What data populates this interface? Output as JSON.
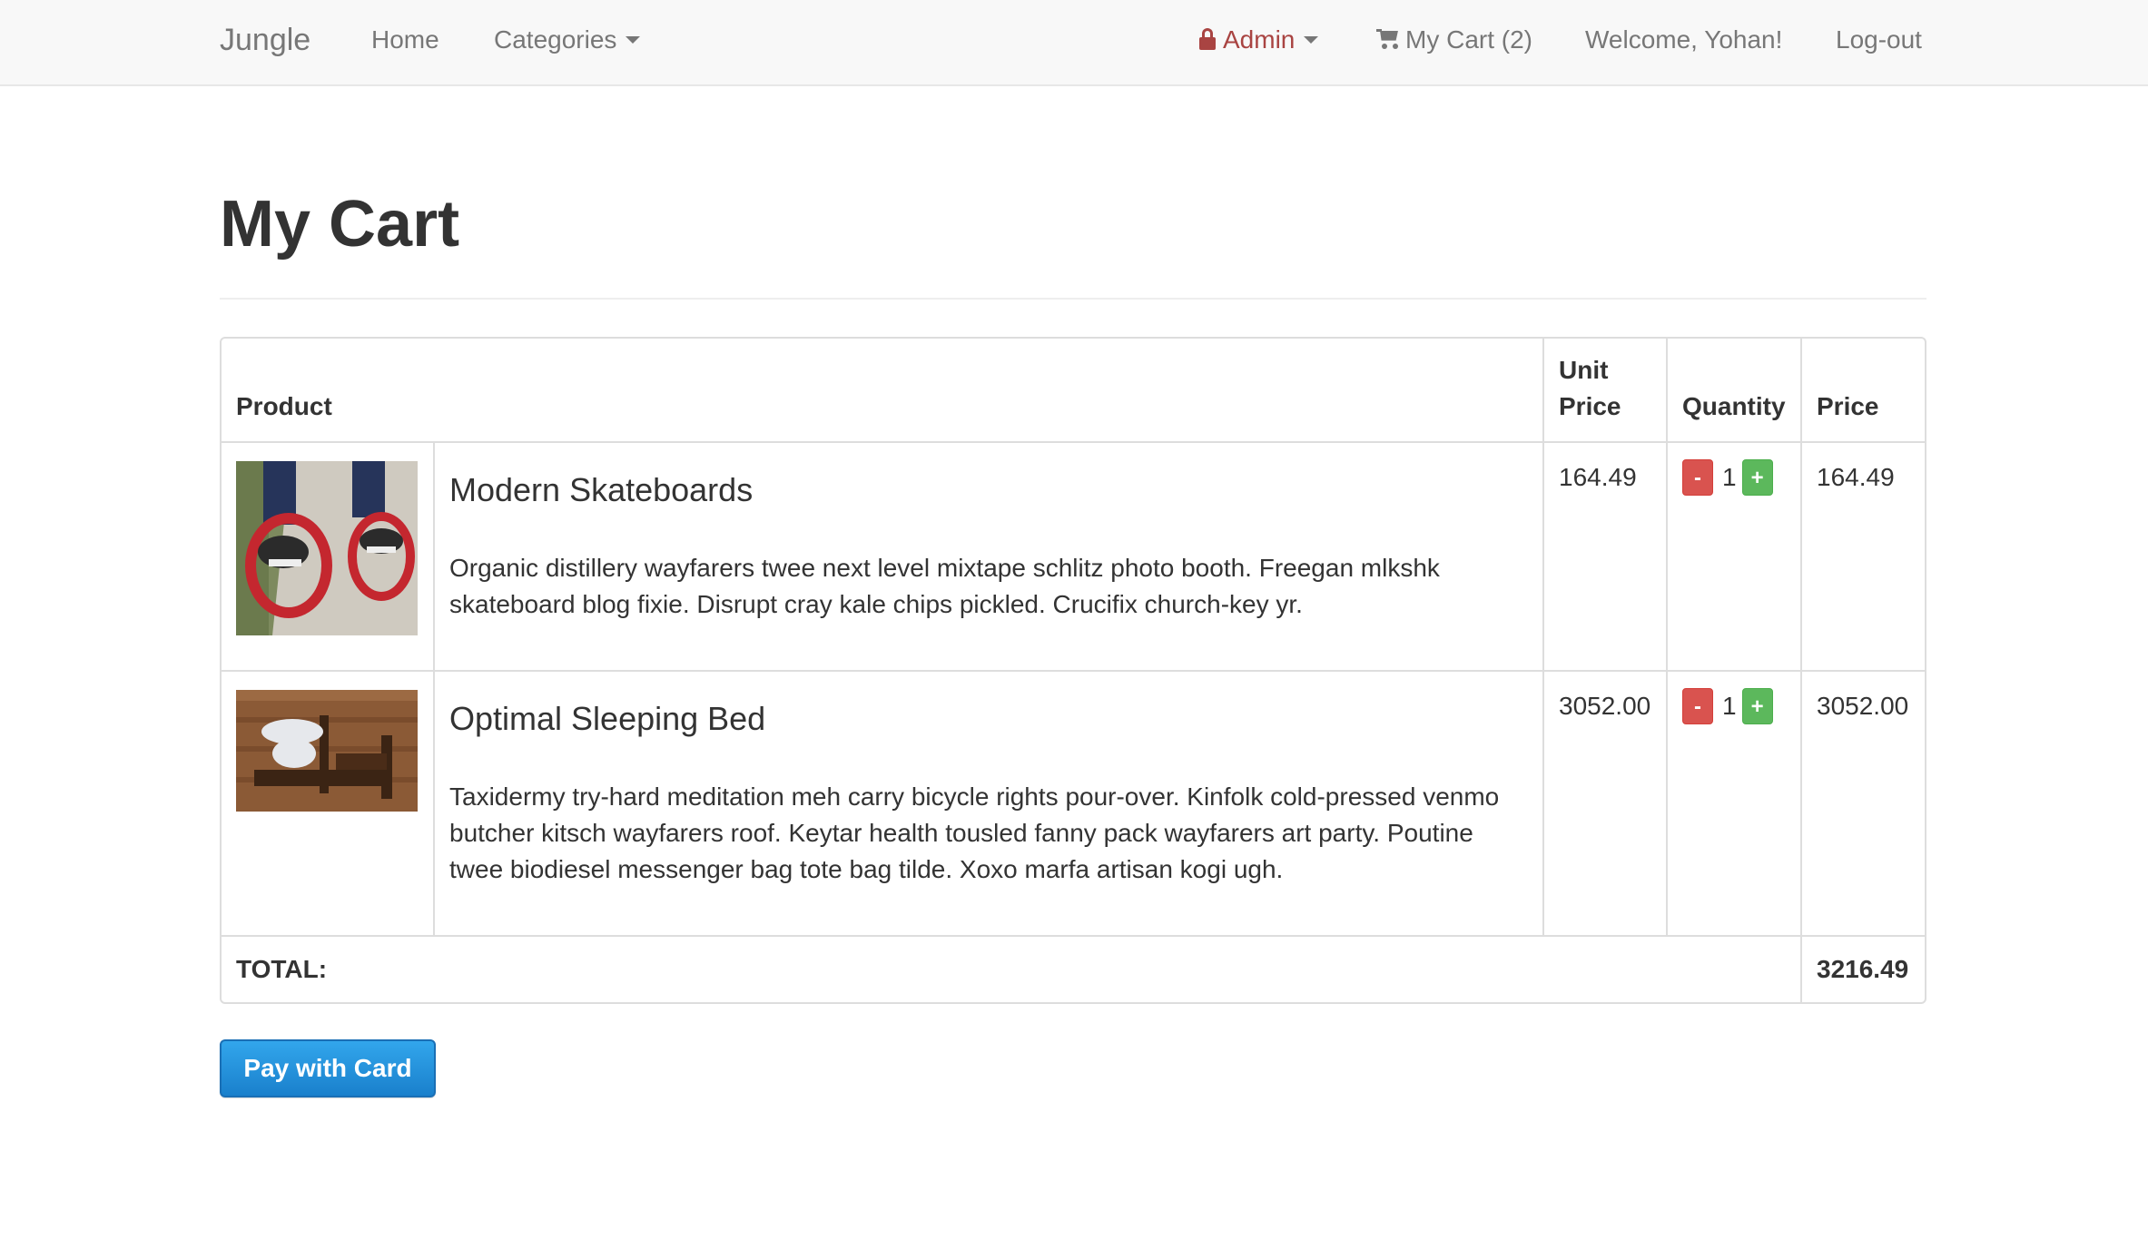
{
  "navbar": {
    "brand": "Jungle",
    "home": "Home",
    "categories": "Categories",
    "admin": "Admin",
    "cart": "My Cart (2)",
    "welcome": "Welcome, Yohan!",
    "logout": "Log-out"
  },
  "page": {
    "title": "My Cart"
  },
  "table": {
    "headers": {
      "product": "Product",
      "unit_price_line1": "Unit",
      "unit_price_line2": "Price",
      "quantity": "Quantity",
      "price": "Price"
    },
    "items": [
      {
        "name": "Modern Skateboards",
        "description": "Organic distillery wayfarers twee next level mixtape schlitz photo booth. Freegan mlkshk skateboard blog fixie. Disrupt cray kale chips pickled. Crucifix church-key yr.",
        "unit_price": "164.49",
        "quantity": "1",
        "price": "164.49",
        "minus": "-",
        "plus": "+"
      },
      {
        "name": "Optimal Sleeping Bed",
        "description": "Taxidermy try-hard meditation meh carry bicycle rights pour-over. Kinfolk cold-pressed venmo butcher kitsch wayfarers roof. Keytar health tousled fanny pack wayfarers art party. Poutine twee biodiesel messenger bag tote bag tilde. Xoxo marfa artisan kogi ugh.",
        "unit_price": "3052.00",
        "quantity": "1",
        "price": "3052.00",
        "minus": "-",
        "plus": "+"
      }
    ],
    "total_label": "TOTAL:",
    "total_value": "3216.49"
  },
  "actions": {
    "pay": "Pay with Card"
  },
  "colors": {
    "accent_blue": "#1a80cc",
    "admin_red": "#a94442",
    "minus_red": "#d9534f",
    "plus_green": "#5cb85c"
  }
}
